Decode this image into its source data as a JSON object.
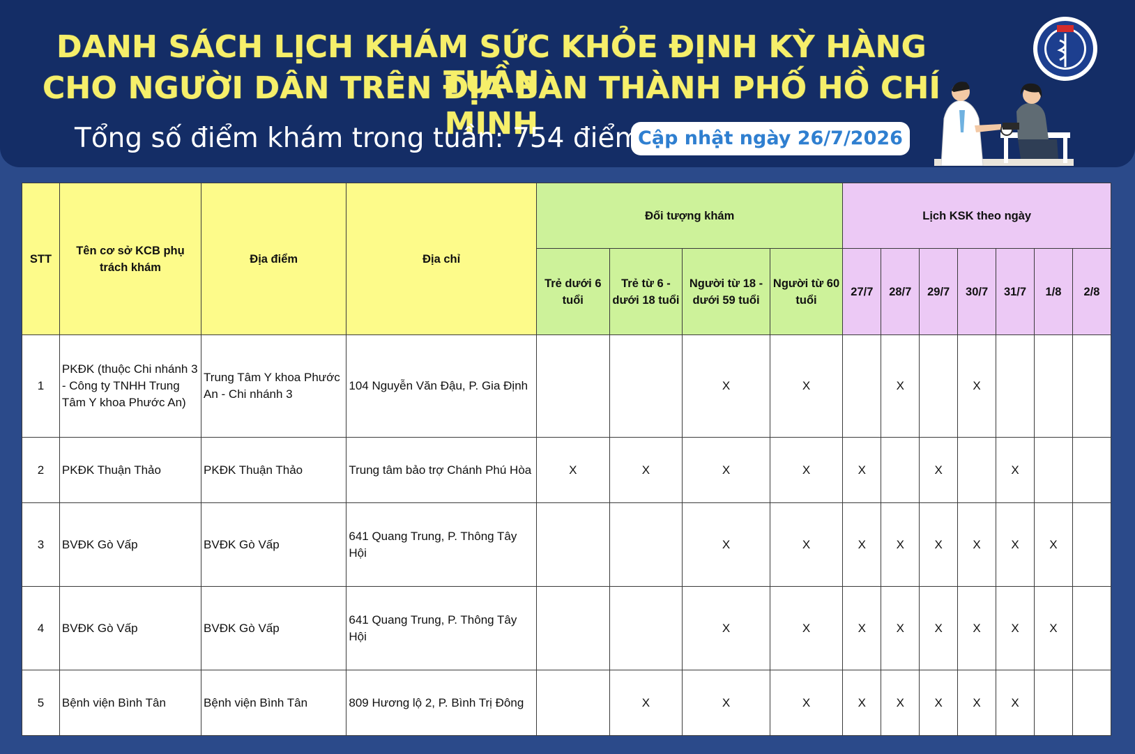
{
  "header": {
    "title_line1": "DANH SÁCH LỊCH KHÁM SỨC KHỎE ĐỊNH KỲ HÀNG TUẦN",
    "title_line2": "CHO NGƯỜI DÂN TRÊN ĐỊA BÀN THÀNH PHỐ HỒ CHÍ MINH",
    "total_points": "Tổng số điểm khám trong tuần: 754 điểm",
    "update_badge": "Cập nhật ngày 26/7/2026"
  },
  "colors": {
    "banner_bg": "#142d66",
    "title": "#f6ef6a",
    "header_yellow": "#fdfb8a",
    "header_green": "#cdf29a",
    "header_purple": "#ecc9f5",
    "update_text": "#2f7fd0"
  },
  "icons": [
    "health-department-logo-icon",
    "doctor-patient-illustration"
  ],
  "table": {
    "col_stt": "STT",
    "col_facility": "Tên cơ sở KCB phụ trách khám",
    "col_location": "Địa điểm",
    "col_address": "Địa chỉ",
    "group_target": "Đối tượng khám",
    "group_schedule": "Lịch KSK theo ngày",
    "targets": [
      "Trẻ dưới 6 tuổi",
      "Trẻ từ 6 - dưới 18 tuổi",
      "Người từ 18 - dưới 59 tuổi",
      "Người từ 60 tuổi"
    ],
    "days": [
      "27/7",
      "28/7",
      "29/7",
      "30/7",
      "31/7",
      "1/8",
      "2/8"
    ],
    "rows": [
      {
        "stt": "1",
        "facility": "PKĐK (thuộc Chi nhánh 3 - Công ty TNHH Trung Tâm Y khoa Phước An)",
        "location": "Trung Tâm Y khoa Phước An - Chi nhánh 3",
        "address": "104 Nguyễn Văn Đậu, P. Gia Định",
        "targets": [
          "",
          "",
          "X",
          "X"
        ],
        "days": [
          "",
          "X",
          "",
          "X",
          "",
          "",
          ""
        ]
      },
      {
        "stt": "2",
        "facility": "PKĐK Thuận Thảo",
        "location": "PKĐK Thuận Thảo",
        "address": "Trung tâm bảo trợ Chánh Phú Hòa",
        "targets": [
          "X",
          "X",
          "X",
          "X"
        ],
        "days": [
          "X",
          "",
          "X",
          "",
          "X",
          "",
          ""
        ]
      },
      {
        "stt": "3",
        "facility": "BVĐK Gò Vấp",
        "location": "BVĐK Gò Vấp",
        "address": "641 Quang Trung, P. Thông Tây Hội",
        "targets": [
          "",
          "",
          "X",
          "X"
        ],
        "days": [
          "X",
          "X",
          "X",
          "X",
          "X",
          "X",
          ""
        ]
      },
      {
        "stt": "4",
        "facility": "BVĐK Gò Vấp",
        "location": "BVĐK Gò Vấp",
        "address": "641 Quang Trung, P. Thông Tây Hội",
        "targets": [
          "",
          "",
          "X",
          "X"
        ],
        "days": [
          "X",
          "X",
          "X",
          "X",
          "X",
          "X",
          ""
        ]
      },
      {
        "stt": "5",
        "facility": "Bệnh viện Bình Tân",
        "location": "Bệnh viện Bình Tân",
        "address": "809 Hương lộ 2, P. Bình Trị Đông",
        "targets": [
          "",
          "X",
          "X",
          "X"
        ],
        "days": [
          "X",
          "X",
          "X",
          "X",
          "X",
          "",
          ""
        ]
      }
    ]
  }
}
